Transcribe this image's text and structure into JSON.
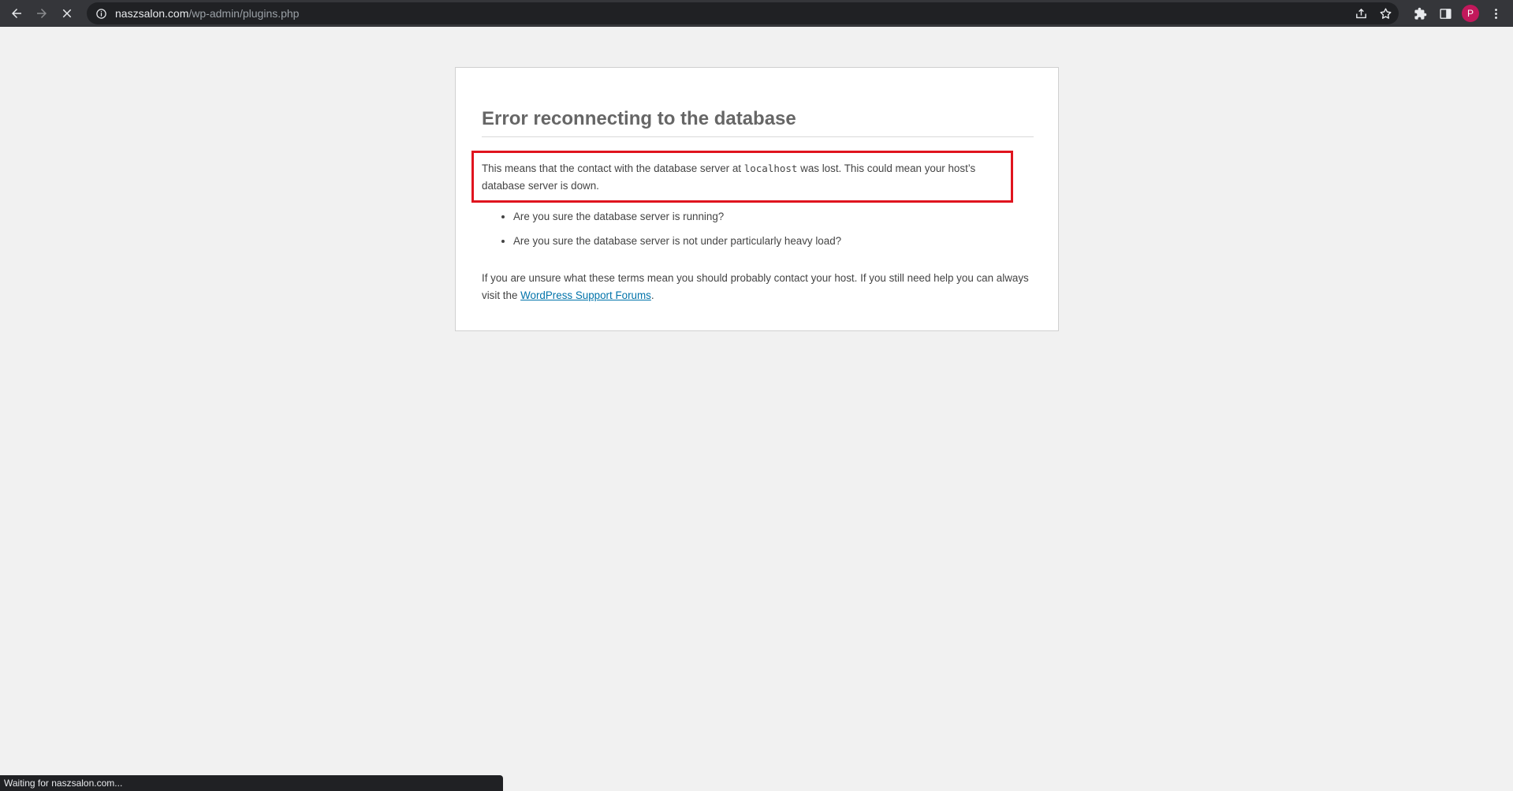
{
  "browser": {
    "url_host": "naszsalon.com",
    "url_path": "/wp-admin/plugins.php",
    "avatar_letter": "P",
    "avatar_color": "#c2185b",
    "status_text": "Waiting for naszsalon.com..."
  },
  "error": {
    "title": "Error reconnecting to the database",
    "para1_before": "This means that the contact with the database server at ",
    "para1_code": "localhost",
    "para1_after": " was lost. This could mean your host’s database server is down.",
    "bullets": [
      "Are you sure the database server is running?",
      "Are you sure the database server is not under particularly heavy load?"
    ],
    "para2_before": "If you are unsure what these terms mean you should probably contact your host. If you still need help you can always visit the ",
    "para2_link": "WordPress Support Forums",
    "para2_after": ".",
    "highlight_color": "#e0141e",
    "link_color": "#0073aa"
  }
}
